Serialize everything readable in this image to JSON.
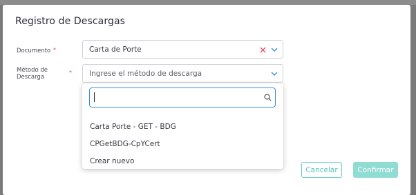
{
  "modal": {
    "title": "Registro de Descargas"
  },
  "form": {
    "documento": {
      "label": "Documento",
      "required_mark": "*",
      "value": "Carta de Porte"
    },
    "metodo": {
      "label_line1": "Método de",
      "label_line2": "Descarga",
      "required_mark": "*",
      "placeholder": "Ingrese el método de descarga"
    }
  },
  "dropdown": {
    "search_value": "",
    "options": [
      "Carta Porte - GET - BDG",
      "CPGetBDG-CpYCert",
      "Crear nuevo"
    ]
  },
  "buttons": {
    "cancel_label": "Cancelar",
    "confirm_label": "Confirmar"
  },
  "colors": {
    "accent": "#3b8fd4",
    "teal": "#52c4b8",
    "teal_disabled": "#8fdcd3",
    "clear_icon": "#e0445c",
    "required": "#e0445c"
  },
  "icons": {
    "clear": "close-icon",
    "chevron": "chevron-down-icon",
    "search": "search-icon"
  }
}
